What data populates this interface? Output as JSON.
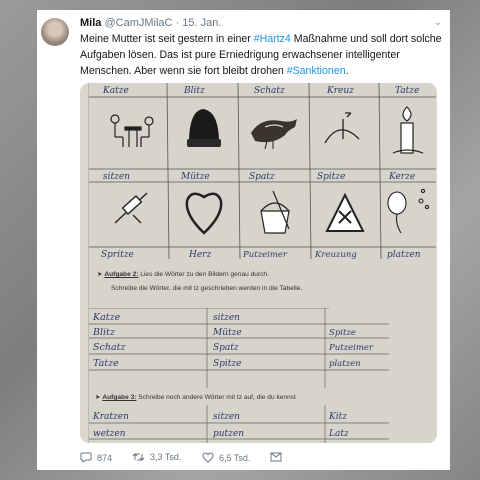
{
  "tweet": {
    "author_name": "Mila",
    "handle": "@CamJMilaC",
    "separator": " · ",
    "date": "15. Jan.",
    "text_parts": [
      {
        "text": "Meine Mutter ist seit gestern in einer ",
        "tag": false
      },
      {
        "text": "#Hartz4",
        "tag": true
      },
      {
        "text": " Maßnahme und soll dort solche Aufgaben lösen. Das ist pure Erniedrigung erwachsener intelligenter Menschen. Aber wenn sie fort bleibt drohen ",
        "tag": false
      },
      {
        "text": "#Sanktionen",
        "tag": true
      },
      {
        "text": ".",
        "tag": false
      }
    ],
    "actions": {
      "replies": "874",
      "retweets": "3,3 Tsd.",
      "likes": "6,5 Tsd."
    },
    "icons": {
      "reply": "reply-icon",
      "retweet": "retweet-icon",
      "like": "heart-icon",
      "message": "envelope-icon",
      "menu": "chevron-down-icon"
    },
    "colors": {
      "link": "#1b95e0",
      "text": "#14171a",
      "muted": "#657786"
    }
  },
  "worksheet": {
    "top_words": [
      "Katze",
      "Blitz",
      "Schatz",
      "Kreuz",
      "Tatze"
    ],
    "row1_words": [
      "sitzen",
      "Mütze",
      "Spatz",
      "Spitze",
      "Kerze"
    ],
    "row2_words": [
      "Spritze",
      "Herz",
      "Putzeimer",
      "Kreuzung",
      "platzen"
    ],
    "row1_pictures": [
      "sitting-people",
      "hat",
      "sparrow",
      "arrow-tip",
      "candle"
    ],
    "row2_pictures": [
      "syringe",
      "heart",
      "bucket",
      "warning-sign",
      "balloon"
    ],
    "task2_label": "Aufgabe 2:",
    "task2_line1": "Lies die Wörter zu den Bildern genau durch.",
    "task2_line2": "Schreibe die Wörter, die mit tz geschrieben werden in die Tabelle.",
    "table_col1": [
      "Katze",
      "Blitz",
      "Schatz",
      "Tatze"
    ],
    "table_col2": [
      "sitzen",
      "Mütze",
      "Spatz",
      "Spitze"
    ],
    "table_col3": [
      "Spitze",
      "Putzeimer",
      "platzen"
    ],
    "task3_label": "Aufgabe 3:",
    "task3_text": "Schreibe noch andere Wörter mit tz auf, die du kennst",
    "task3_col1": [
      "Kratzen",
      "wetzen"
    ],
    "task3_col2": [
      "sitzen",
      "putzen"
    ],
    "task3_col3": [
      "Kitz",
      "Latz"
    ]
  }
}
